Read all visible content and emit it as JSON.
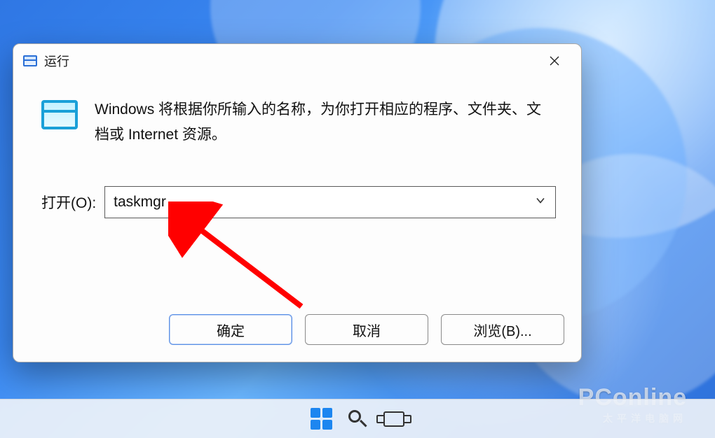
{
  "dialog": {
    "title": "运行",
    "description": "Windows 将根据你所输入的名称，为你打开相应的程序、文件夹、文档或 Internet 资源。",
    "open_label": "打开(O):",
    "open_value": "taskmgr",
    "buttons": {
      "ok": "确定",
      "cancel": "取消",
      "browse": "浏览(B)..."
    }
  },
  "watermark": {
    "main": "PConline",
    "sub": "太平洋电脑网"
  }
}
